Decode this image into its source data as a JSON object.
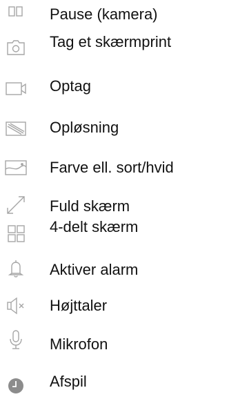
{
  "colors": {
    "icon_stroke": "#a6a6a6",
    "icon_fill_dark": "#8c8c8c",
    "text": "#111111"
  },
  "items": [
    {
      "icon": "pause-icon",
      "label": "Pause (kamera)"
    },
    {
      "icon": "camera-icon",
      "label": "Tag et skærmprint"
    },
    {
      "icon": "video-camera-icon",
      "label": "Optag"
    },
    {
      "icon": "resolution-icon",
      "label": "Opløsning"
    },
    {
      "icon": "color-bw-icon",
      "label": "Farve ell. sort/hvid"
    },
    {
      "icon": "fullscreen-icon",
      "label": "Fuld skærm"
    },
    {
      "icon": "split-screen-icon",
      "label": "4-delt skærm"
    },
    {
      "icon": "bell-icon",
      "label": "Aktiver alarm"
    },
    {
      "icon": "speaker-muted-icon",
      "label": "Højttaler"
    },
    {
      "icon": "microphone-icon",
      "label": "Mikrofon"
    },
    {
      "icon": "playback-icon",
      "label": "Afspil"
    }
  ]
}
